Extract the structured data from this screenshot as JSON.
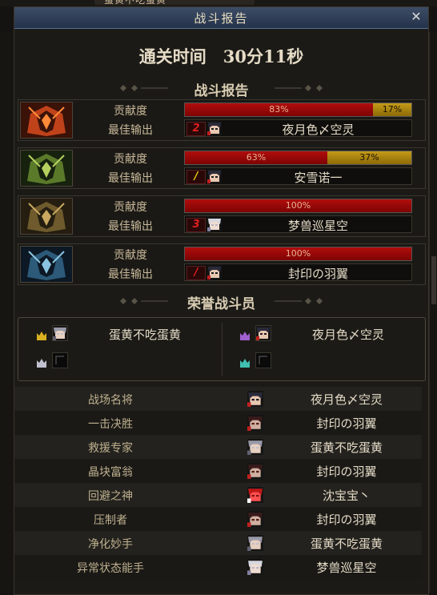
{
  "window": {
    "title": "战斗报告",
    "close_glyph": "✕"
  },
  "top_fragment": "蛋黄不吃蛋黄",
  "clear_time": "通关时间　30分11秒",
  "section_report": "战斗报告",
  "section_honor": "荣誉战斗员",
  "labels": {
    "contribution": "贡献度",
    "best_output": "最佳输出"
  },
  "colors": {
    "bar_red": "#a00a0a",
    "bar_gold": "#b08a10",
    "accent_text": "#e4dac6"
  },
  "bosses": [
    {
      "portrait": "boss-1-red-portrait",
      "contrib_red": 0.83,
      "contrib_red_label": "83%",
      "contrib_gold": 0.17,
      "contrib_gold_label": "17%",
      "rank": "2",
      "rank_color": "#e02020",
      "avatar": "avatar-dark-hair",
      "name": "夜月色〆空灵"
    },
    {
      "portrait": "boss-2-green-portrait",
      "contrib_red": 0.63,
      "contrib_red_label": "63%",
      "contrib_gold": 0.37,
      "contrib_gold_label": "37%",
      "rank": "/",
      "rank_color": "#e8d010",
      "avatar": "avatar-dark-hair",
      "name": "安雪诺一"
    },
    {
      "portrait": "boss-3-gold-portrait",
      "contrib_red": 1.0,
      "contrib_red_label": "100%",
      "contrib_gold": 0,
      "contrib_gold_label": "",
      "rank": "3",
      "rank_color": "#e02020",
      "avatar": "avatar-white-hair",
      "name": "梦兽巡星空"
    },
    {
      "portrait": "boss-4-blue-portrait",
      "contrib_red": 1.0,
      "contrib_red_label": "100%",
      "contrib_gold": 0,
      "contrib_gold_label": "",
      "rank": "/",
      "rank_color": "#e02020",
      "avatar": "avatar-dark-hair",
      "name": "封印の羽翼"
    }
  ],
  "honor": [
    {
      "crown": "gold-crown-icon",
      "avatar": "avatar-silver-hair",
      "name": "蛋黄不吃蛋黄"
    },
    {
      "crown": "purple-crown-icon",
      "avatar": "avatar-dark-hair",
      "name": "夜月色〆空灵"
    },
    {
      "crown": "silver-crown-icon",
      "avatar": "empty-slot",
      "name": ""
    },
    {
      "crown": "teal-crown-icon",
      "avatar": "empty-slot",
      "name": ""
    }
  ],
  "awards": [
    {
      "title": "战场名将",
      "avatar": "avatar-dark-hair",
      "name": "夜月色〆空灵"
    },
    {
      "title": "一击决胜",
      "avatar": "avatar-red-dark",
      "name": "封印の羽翼"
    },
    {
      "title": "救援专家",
      "avatar": "avatar-silver-hair",
      "name": "蛋黄不吃蛋黄"
    },
    {
      "title": "晶块富翁",
      "avatar": "avatar-red-dark",
      "name": "封印の羽翼"
    },
    {
      "title": "回避之神",
      "avatar": "avatar-red-creature",
      "name": "沈宝宝丶"
    },
    {
      "title": "压制者",
      "avatar": "avatar-red-dark",
      "name": "封印の羽翼"
    },
    {
      "title": "净化妙手",
      "avatar": "avatar-silver-hair",
      "name": "蛋黄不吃蛋黄"
    },
    {
      "title": "异常状态能手",
      "avatar": "avatar-white-hair",
      "name": "梦兽巡星空"
    }
  ]
}
